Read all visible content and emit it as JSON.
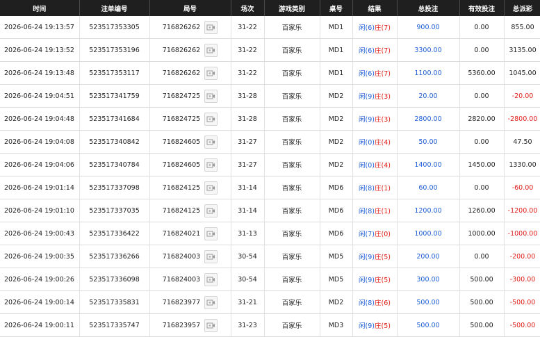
{
  "columns": [
    "时间",
    "注单编号",
    "局号",
    "场次",
    "游戏类别",
    "桌号",
    "结果",
    "总投注",
    "有效投注",
    "总派彩"
  ],
  "colors": {
    "player": "#1f5fd6",
    "banker": "#e0201b",
    "loss": "#e0201b",
    "header_bg": "#1f1f1f"
  },
  "rows": [
    {
      "time": "2026-06-24 19:13:57",
      "bet_id": "523517353305",
      "round": "716826262",
      "shoe": "31-22",
      "game": "百家乐",
      "table": "MD1",
      "player": "闲(6)",
      "banker": "庄(7)",
      "total": "900.00",
      "valid": "0.00",
      "payout": "855.00",
      "payout_neg": false
    },
    {
      "time": "2026-06-24 19:13:52",
      "bet_id": "523517353196",
      "round": "716826262",
      "shoe": "31-22",
      "game": "百家乐",
      "table": "MD1",
      "player": "闲(6)",
      "banker": "庄(7)",
      "total": "3300.00",
      "valid": "0.00",
      "payout": "3135.00",
      "payout_neg": false
    },
    {
      "time": "2026-06-24 19:13:48",
      "bet_id": "523517353117",
      "round": "716826262",
      "shoe": "31-22",
      "game": "百家乐",
      "table": "MD1",
      "player": "闲(6)",
      "banker": "庄(7)",
      "total": "1100.00",
      "valid": "5360.00",
      "payout": "1045.00",
      "payout_neg": false
    },
    {
      "time": "2026-06-24 19:04:51",
      "bet_id": "523517341759",
      "round": "716824725",
      "shoe": "31-28",
      "game": "百家乐",
      "table": "MD2",
      "player": "闲(9)",
      "banker": "庄(3)",
      "total": "20.00",
      "valid": "0.00",
      "payout": "-20.00",
      "payout_neg": true
    },
    {
      "time": "2026-06-24 19:04:48",
      "bet_id": "523517341684",
      "round": "716824725",
      "shoe": "31-28",
      "game": "百家乐",
      "table": "MD2",
      "player": "闲(9)",
      "banker": "庄(3)",
      "total": "2800.00",
      "valid": "2820.00",
      "payout": "-2800.00",
      "payout_neg": true
    },
    {
      "time": "2026-06-24 19:04:08",
      "bet_id": "523517340842",
      "round": "716824605",
      "shoe": "31-27",
      "game": "百家乐",
      "table": "MD2",
      "player": "闲(0)",
      "banker": "庄(4)",
      "total": "50.00",
      "valid": "0.00",
      "payout": "47.50",
      "payout_neg": false
    },
    {
      "time": "2026-06-24 19:04:06",
      "bet_id": "523517340784",
      "round": "716824605",
      "shoe": "31-27",
      "game": "百家乐",
      "table": "MD2",
      "player": "闲(0)",
      "banker": "庄(4)",
      "total": "1400.00",
      "valid": "1450.00",
      "payout": "1330.00",
      "payout_neg": false
    },
    {
      "time": "2026-06-24 19:01:14",
      "bet_id": "523517337098",
      "round": "716824125",
      "shoe": "31-14",
      "game": "百家乐",
      "table": "MD6",
      "player": "闲(8)",
      "banker": "庄(1)",
      "total": "60.00",
      "valid": "0.00",
      "payout": "-60.00",
      "payout_neg": true
    },
    {
      "time": "2026-06-24 19:01:10",
      "bet_id": "523517337035",
      "round": "716824125",
      "shoe": "31-14",
      "game": "百家乐",
      "table": "MD6",
      "player": "闲(8)",
      "banker": "庄(1)",
      "total": "1200.00",
      "valid": "1260.00",
      "payout": "-1200.00",
      "payout_neg": true
    },
    {
      "time": "2026-06-24 19:00:43",
      "bet_id": "523517336422",
      "round": "716824021",
      "shoe": "31-13",
      "game": "百家乐",
      "table": "MD6",
      "player": "闲(7)",
      "banker": "庄(0)",
      "total": "1000.00",
      "valid": "1000.00",
      "payout": "-1000.00",
      "payout_neg": true
    },
    {
      "time": "2026-06-24 19:00:35",
      "bet_id": "523517336266",
      "round": "716824003",
      "shoe": "30-54",
      "game": "百家乐",
      "table": "MD5",
      "player": "闲(9)",
      "banker": "庄(5)",
      "total": "200.00",
      "valid": "0.00",
      "payout": "-200.00",
      "payout_neg": true
    },
    {
      "time": "2026-06-24 19:00:26",
      "bet_id": "523517336098",
      "round": "716824003",
      "shoe": "30-54",
      "game": "百家乐",
      "table": "MD5",
      "player": "闲(9)",
      "banker": "庄(5)",
      "total": "300.00",
      "valid": "500.00",
      "payout": "-300.00",
      "payout_neg": true
    },
    {
      "time": "2026-06-24 19:00:14",
      "bet_id": "523517335831",
      "round": "716823977",
      "shoe": "31-21",
      "game": "百家乐",
      "table": "MD2",
      "player": "闲(8)",
      "banker": "庄(6)",
      "total": "500.00",
      "valid": "500.00",
      "payout": "-500.00",
      "payout_neg": true
    },
    {
      "time": "2026-06-24 19:00:11",
      "bet_id": "523517335747",
      "round": "716823957",
      "shoe": "31-23",
      "game": "百家乐",
      "table": "MD3",
      "player": "闲(9)",
      "banker": "庄(5)",
      "total": "500.00",
      "valid": "500.00",
      "payout": "-500.00",
      "payout_neg": true
    }
  ]
}
